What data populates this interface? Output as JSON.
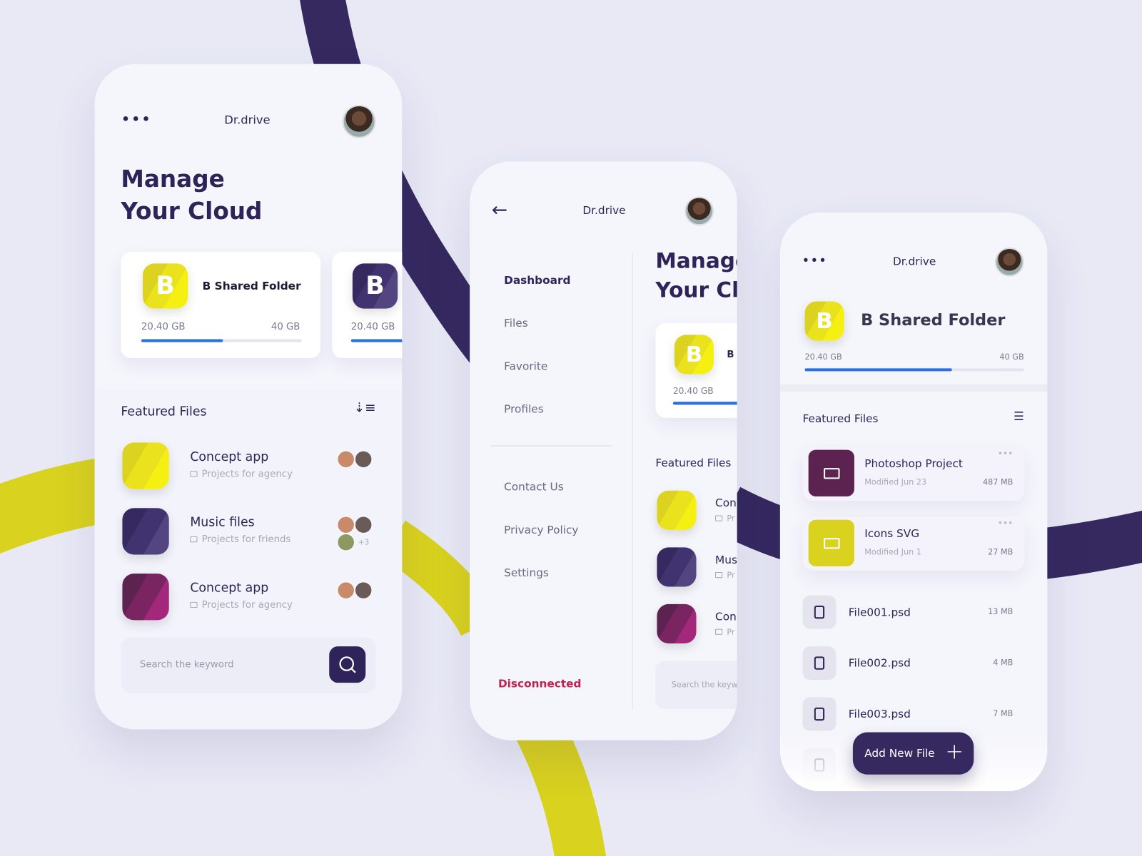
{
  "colors": {
    "background": "#e8e9f5",
    "primary": "#2f2459",
    "accent_yellow": "#e2da1c",
    "plum": "#5c2350",
    "progress": "#2b6fe0",
    "danger": "#c0244d"
  },
  "app_name": "Dr.drive",
  "screen1": {
    "heading_line1": "Manage",
    "heading_line2": "Your Cloud",
    "folder_card": {
      "letter": "B",
      "name": "B Shared Folder",
      "used": "20.40 GB",
      "total": "40 GB",
      "progress_fraction": 0.51
    },
    "folder_card2": {
      "letter": "B",
      "used": "20.40 GB"
    },
    "featured_title": "Featured Files",
    "sort_icon": "sort-descending-icon",
    "files": [
      {
        "name": "Concept app",
        "subtitle": "Projects for agency",
        "color": "yellow"
      },
      {
        "name": "Music files",
        "subtitle": "Projects for friends",
        "color": "purple",
        "extra": "+3"
      },
      {
        "name": "Concept app",
        "subtitle": "Projects for agency",
        "color": "plum"
      }
    ],
    "search_placeholder": "Search the keyword"
  },
  "screen2": {
    "menu": [
      "Dashboard",
      "Files",
      "Favorite",
      "Profiles"
    ],
    "menu2": [
      "Contact Us",
      "Privacy Policy",
      "Settings"
    ],
    "disconnect": "Disconnected",
    "heading_line1": "Manage",
    "heading_line2": "Your Clo",
    "card": {
      "letter": "B",
      "name": "B S",
      "used": "20.40 GB"
    },
    "featured_title": "Featured Files",
    "files": [
      "Con",
      "Mus",
      "Con"
    ],
    "file_sub": "Pr",
    "search_placeholder": "Search the keyw"
  },
  "screen3": {
    "folder": {
      "letter": "B",
      "name": "B Shared Folder",
      "used": "20.40 GB",
      "total": "40 GB",
      "progress_fraction": 0.67
    },
    "featured_title": "Featured Files",
    "list_icon": "list-icon",
    "folders": [
      {
        "name": "Photoshop Project",
        "modified": "Modified Jun 23",
        "size": "487 MB",
        "color": "#5c2350"
      },
      {
        "name": "Icons SVG",
        "modified": "Modified Jun 1",
        "size": "27 MB",
        "color": "#d9d21e"
      }
    ],
    "files": [
      {
        "name": "File001.psd",
        "size": "13 MB"
      },
      {
        "name": "File002.psd",
        "size": "4 MB"
      },
      {
        "name": "File003.psd",
        "size": "7 MB"
      }
    ],
    "add_button": "Add New File"
  }
}
